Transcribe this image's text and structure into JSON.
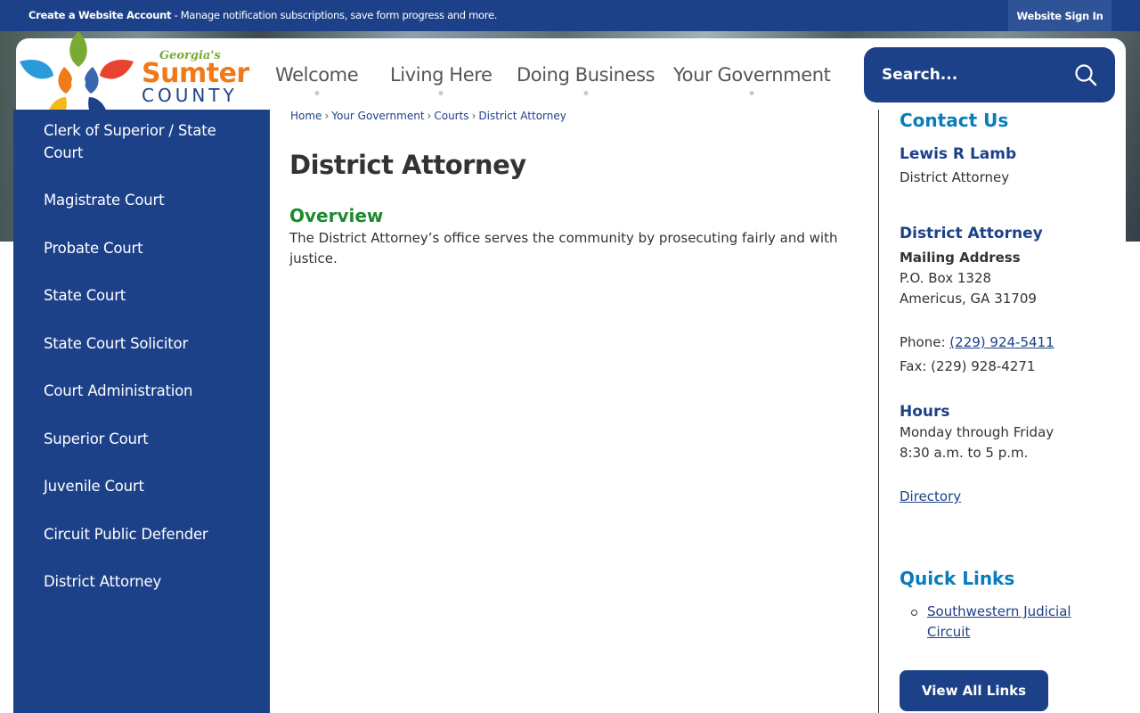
{
  "topbar": {
    "create_account": "Create a Website Account",
    "notice_rest": " - Manage notification subscriptions, save form progress and more.",
    "sign_in": "Website Sign In"
  },
  "logo": {
    "line1": "Georgia's",
    "line2": "Sumter",
    "line3": "COUNTY"
  },
  "nav": {
    "items": [
      "Welcome",
      "Living Here",
      "Doing Business",
      "Your Government"
    ]
  },
  "search": {
    "placeholder": "Search..."
  },
  "sidebar": {
    "items": [
      "Clerk of Superior / State Court",
      "Magistrate Court",
      "Probate Court",
      "State Court",
      "State Court Solicitor",
      "Court Administration",
      "Superior Court",
      "Juvenile Court",
      "Circuit Public Defender",
      "District Attorney"
    ]
  },
  "breadcrumb": {
    "items": [
      "Home",
      "Your Government",
      "Courts",
      "District Attorney"
    ],
    "separator": "›"
  },
  "main": {
    "title": "District Attorney",
    "overview_heading": "Overview",
    "overview_text": "The District Attorney’s office serves the community by prosecuting fairly and with justice."
  },
  "contact": {
    "heading": "Contact Us",
    "person_name": "Lewis R Lamb",
    "person_title": "District Attorney",
    "office_heading": "District Attorney",
    "mailing_label": "Mailing Address",
    "address_line1": "P.O. Box 1328",
    "address_line2": "Americus, GA 31709",
    "phone_label": "Phone: ",
    "phone": "(229) 924-5411",
    "fax": "Fax: (229) 928-4271",
    "hours_heading": "Hours",
    "hours_line1": "Monday through Friday",
    "hours_line2": "8:30 a.m. to 5 p.m.",
    "directory_link": "Directory"
  },
  "quick_links": {
    "heading": "Quick Links",
    "items": [
      "Southwestern Judicial Circuit"
    ],
    "view_all": "View All Links"
  },
  "colors": {
    "navy": "#1d4189",
    "heading_blue": "#0a7bbd",
    "overview_green": "#1e8a2e",
    "logo_orange": "#f07a1a"
  }
}
